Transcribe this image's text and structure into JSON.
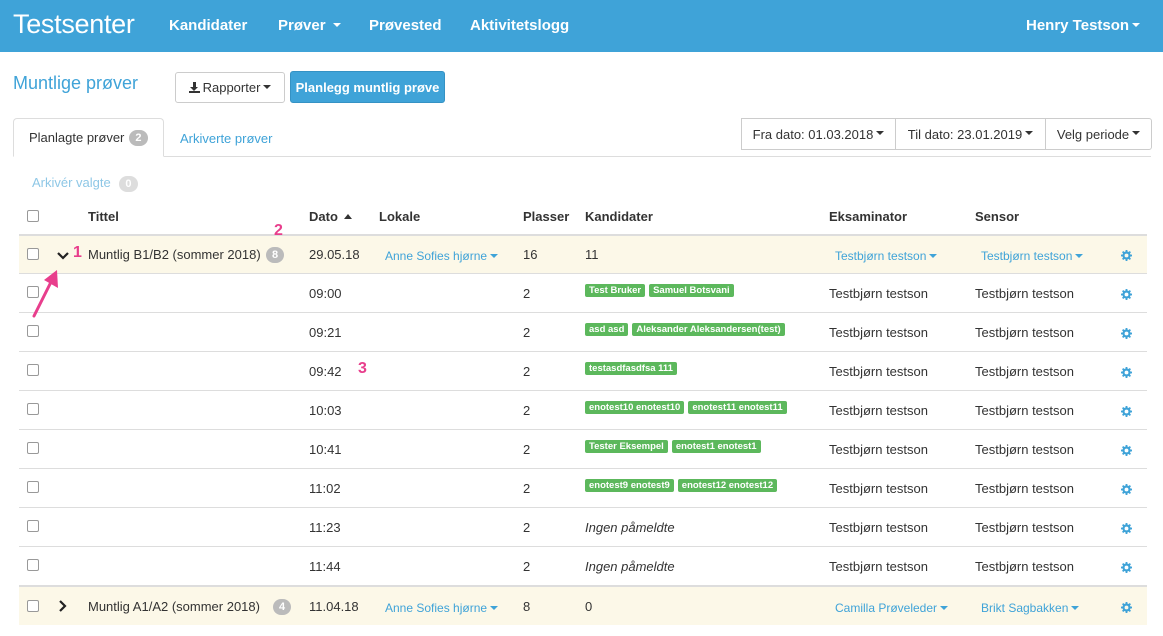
{
  "navbar": {
    "brand": "Testsenter",
    "items": [
      {
        "label": "Kandidater",
        "caret": false
      },
      {
        "label": "Prøver",
        "caret": true
      },
      {
        "label": "Prøvested",
        "caret": false
      },
      {
        "label": "Aktivitetslogg",
        "caret": false
      }
    ],
    "user": "Henry Testson"
  },
  "page": {
    "title": "Muntlige prøver",
    "reports_button": "Rapporter",
    "plan_button": "Planlegg muntlig prøve"
  },
  "tabs": {
    "planned": {
      "label": "Planlagte prøver",
      "count": "2"
    },
    "archived": {
      "label": "Arkiverte prøver"
    }
  },
  "filters": {
    "from": "Fra dato: 01.03.2018",
    "to": "Til dato: 23.01.2019",
    "period": "Velg periode"
  },
  "archive_selected": {
    "label": "Arkivér valgte",
    "count": "0"
  },
  "table": {
    "headers": {
      "title": "Tittel",
      "date": "Dato",
      "room": "Lokale",
      "seats": "Plasser",
      "candidates": "Kandidater",
      "examiner": "Eksaminator",
      "sensor": "Sensor"
    },
    "group1": {
      "title": "Muntlig B1/B2 (sommer 2018)",
      "count": "8",
      "date": "29.05.18",
      "room": "Anne Sofies hjørne",
      "seats": "16",
      "candidates": "11",
      "examiner": "Testbjørn testson",
      "sensor": "Testbjørn testson"
    },
    "slots": [
      {
        "time": "09:00",
        "seats": "2",
        "tags": [
          "Test Bruker",
          "Samuel Botsvani"
        ],
        "none": "",
        "examiner": "Testbjørn testson",
        "sensor": "Testbjørn testson"
      },
      {
        "time": "09:21",
        "seats": "2",
        "tags": [
          "asd asd",
          "Aleksander Aleksandersen(test)"
        ],
        "none": "",
        "examiner": "Testbjørn testson",
        "sensor": "Testbjørn testson"
      },
      {
        "time": "09:42",
        "seats": "2",
        "tags": [
          "testasdfasdfsa 111"
        ],
        "none": "",
        "examiner": "Testbjørn testson",
        "sensor": "Testbjørn testson"
      },
      {
        "time": "10:03",
        "seats": "2",
        "tags": [
          "enotest10 enotest10",
          "enotest11 enotest11"
        ],
        "none": "",
        "examiner": "Testbjørn testson",
        "sensor": "Testbjørn testson"
      },
      {
        "time": "10:41",
        "seats": "2",
        "tags": [
          "Tester Eksempel",
          "enotest1 enotest1"
        ],
        "none": "",
        "examiner": "Testbjørn testson",
        "sensor": "Testbjørn testson"
      },
      {
        "time": "11:02",
        "seats": "2",
        "tags": [
          "enotest9 enotest9",
          "enotest12 enotest12"
        ],
        "none": "",
        "examiner": "Testbjørn testson",
        "sensor": "Testbjørn testson"
      },
      {
        "time": "11:23",
        "seats": "2",
        "tags": [],
        "none": "Ingen påmeldte",
        "examiner": "Testbjørn testson",
        "sensor": "Testbjørn testson"
      },
      {
        "time": "11:44",
        "seats": "2",
        "tags": [],
        "none": "Ingen påmeldte",
        "examiner": "Testbjørn testson",
        "sensor": "Testbjørn testson"
      }
    ],
    "group2": {
      "title": "Muntlig A1/A2 (sommer 2018)",
      "count": "4",
      "date": "11.04.18",
      "room": "Anne Sofies hjørne",
      "seats": "8",
      "candidates": "0",
      "examiner": "Camilla Prøveleder",
      "sensor": "Brikt Sagbakken"
    }
  },
  "annotations": [
    "1",
    "2",
    "3"
  ],
  "colors": {
    "primary": "#3fa3d8",
    "tag": "#5cb85c",
    "group_row": "#fcf8e8",
    "annotation": "#e83e8c"
  }
}
